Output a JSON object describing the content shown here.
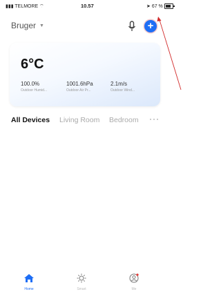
{
  "status_bar": {
    "carrier": "TELMORE",
    "time": "10.57",
    "battery": "67 %"
  },
  "header": {
    "user_name": "Bruger",
    "mic_icon": "microphone-icon",
    "add_icon": "plus-icon",
    "accent_color": "#1e6ef5"
  },
  "weather": {
    "temperature": "6°C",
    "metrics": [
      {
        "value": "100.0%",
        "label": "Outdoor Humid..."
      },
      {
        "value": "1001.6hPa",
        "label": "Outdoor Air Pr..."
      },
      {
        "value": "2.1m/s",
        "label": "Outdoor Wind..."
      }
    ]
  },
  "room_tabs": {
    "tabs": [
      "All Devices",
      "Living Room",
      "Bedroom"
    ],
    "active": "All Devices",
    "more_icon": "more-horizontal-icon"
  },
  "bottom_nav": {
    "items": [
      {
        "label": "Home",
        "icon": "home-icon",
        "active": true
      },
      {
        "label": "Smart",
        "icon": "sun-icon",
        "active": false
      },
      {
        "label": "Me",
        "icon": "user-icon",
        "active": false
      }
    ]
  }
}
